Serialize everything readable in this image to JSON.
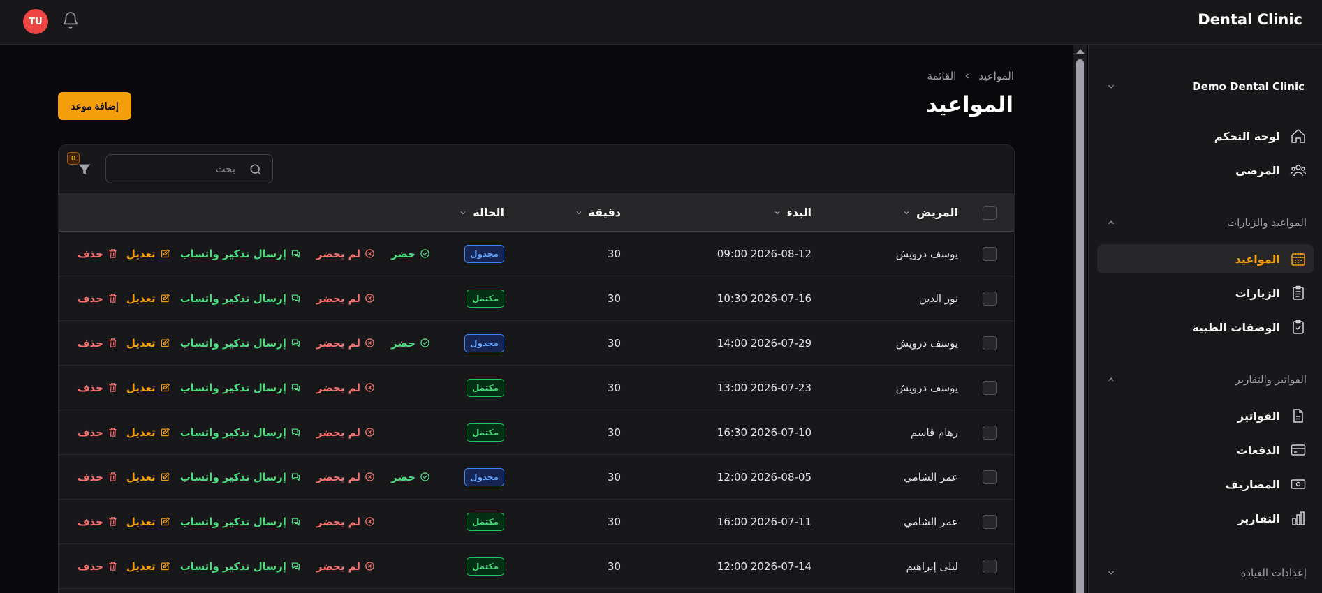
{
  "app": {
    "brand": "Dental Clinic",
    "user_initials": "TU"
  },
  "sidebar": {
    "tenant": "Demo Dental Clinic",
    "items": [
      {
        "label": "لوحة التحكم",
        "icon": "home-icon"
      },
      {
        "label": "المرضى",
        "icon": "users-icon"
      }
    ],
    "group_appointments": "المواعيد والزيارات",
    "appointment_items": [
      {
        "label": "المواعيد",
        "icon": "calendar-icon",
        "active": true
      },
      {
        "label": "الزيارات",
        "icon": "clipboard-icon"
      },
      {
        "label": "الوصفات الطبية",
        "icon": "clipboard-check-icon"
      }
    ],
    "group_billing": "الفواتير والتقارير",
    "billing_items": [
      {
        "label": "الفواتير",
        "icon": "file-icon"
      },
      {
        "label": "الدفعات",
        "icon": "credit-card-icon"
      },
      {
        "label": "المصاريف",
        "icon": "banknote-icon"
      },
      {
        "label": "التقارير",
        "icon": "bar-chart-icon"
      }
    ],
    "group_settings": "إعدادات العيادة"
  },
  "breadcrumb": {
    "root": "المواعيد",
    "current": "القائمة"
  },
  "page": {
    "title": "المواعيد",
    "add_button": "إضافة موعد"
  },
  "table": {
    "search_placeholder": "بحث",
    "filter_count": "0",
    "columns": {
      "patient": "المريض",
      "start": "البدء",
      "minutes": "دقيقة",
      "status": "الحالة"
    },
    "actions": {
      "present": "حضر",
      "no_show": "لم يحضر",
      "whatsapp": "إرسال تذكير واتساب",
      "edit": "تعديل",
      "delete": "حذف"
    },
    "rows": [
      {
        "patient": "يوسف درويش",
        "start": "2026-08-12 09:00",
        "minutes": "30",
        "status": "مجدول",
        "status_type": "scheduled"
      },
      {
        "patient": "نور الدين",
        "start": "2026-07-16 10:30",
        "minutes": "30",
        "status": "مكتمل",
        "status_type": "completed"
      },
      {
        "patient": "يوسف درويش",
        "start": "2026-07-29 14:00",
        "minutes": "30",
        "status": "مجدول",
        "status_type": "scheduled"
      },
      {
        "patient": "يوسف درويش",
        "start": "2026-07-23 13:00",
        "minutes": "30",
        "status": "مكتمل",
        "status_type": "completed"
      },
      {
        "patient": "رهام قاسم",
        "start": "2026-07-10 16:30",
        "minutes": "30",
        "status": "مكتمل",
        "status_type": "completed"
      },
      {
        "patient": "عمر الشامي",
        "start": "2026-08-05 12:00",
        "minutes": "30",
        "status": "مجدول",
        "status_type": "scheduled"
      },
      {
        "patient": "عمر الشامي",
        "start": "2026-07-11 16:00",
        "minutes": "30",
        "status": "مكتمل",
        "status_type": "completed"
      },
      {
        "patient": "ليلى إبراهيم",
        "start": "2026-07-14 12:00",
        "minutes": "30",
        "status": "مكتمل",
        "status_type": "completed"
      }
    ]
  },
  "colors": {
    "accent": "#f59e0b",
    "success": "#4ade80",
    "danger": "#f87171",
    "info": "#60a5fa",
    "avatar": "#ef4444"
  }
}
